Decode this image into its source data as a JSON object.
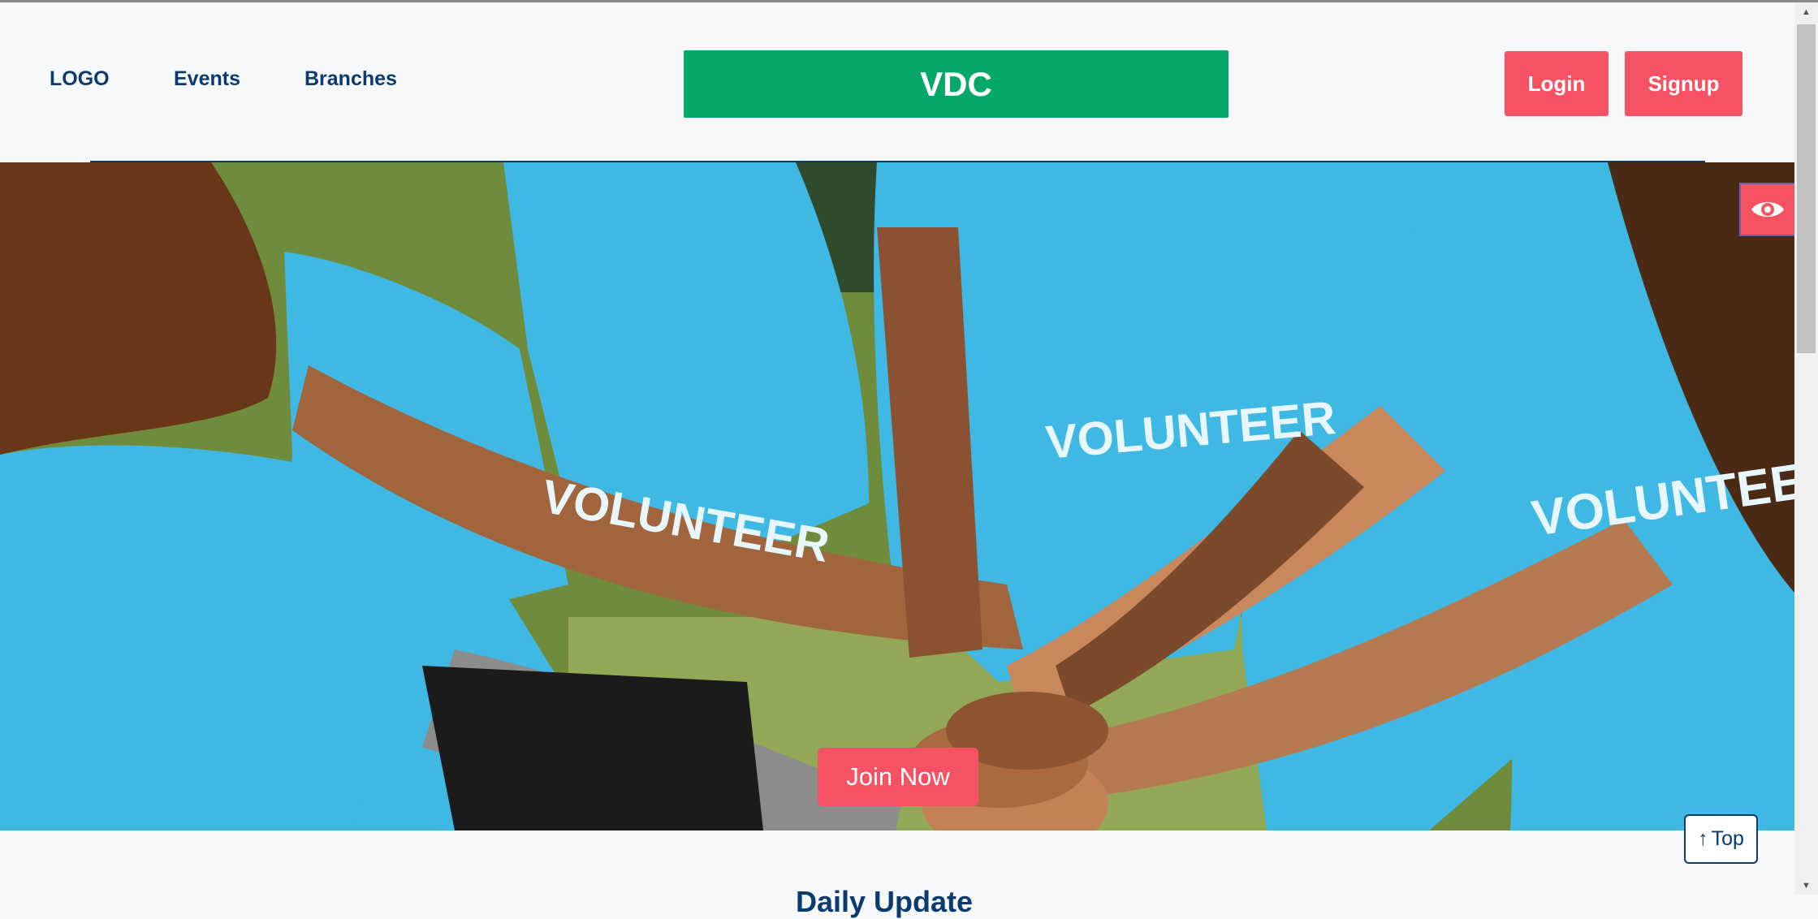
{
  "header": {
    "nav": {
      "logo": "LOGO",
      "events": "Events",
      "branches": "Branches"
    },
    "brand": "VDC",
    "login_label": "Login",
    "signup_label": "Signup"
  },
  "hero": {
    "shirt_text": "VOLUNTEER",
    "join_label": "Join Now"
  },
  "widgets": {
    "accessibility_icon": "eye-icon",
    "top_label": "Top",
    "top_icon": "↑"
  },
  "next_section": {
    "heading_partial": "Daily Update"
  },
  "colors": {
    "navy": "#0b3a6f",
    "brand_green": "#05a866",
    "accent_red": "#f55263",
    "shirt_blue": "#3fb8e4"
  }
}
